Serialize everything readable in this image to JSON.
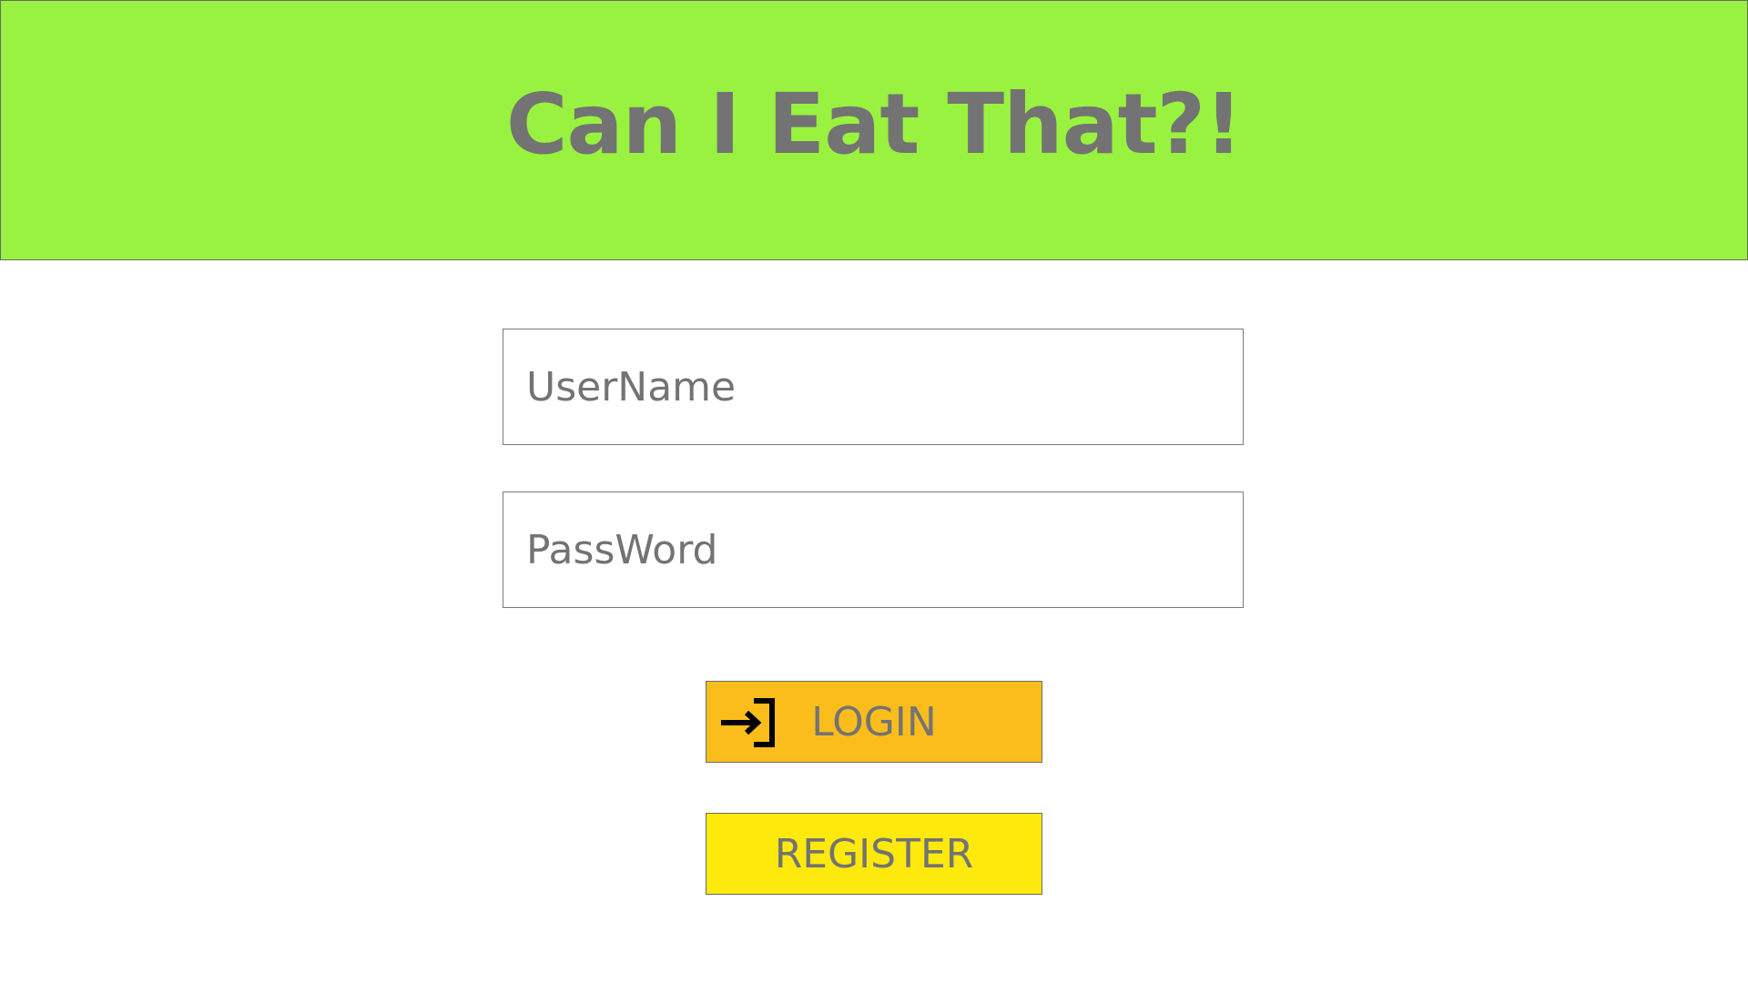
{
  "header": {
    "title": "Can I Eat That?!",
    "background_color": "#99f23f"
  },
  "form": {
    "username_placeholder": "UserName",
    "password_placeholder": "PassWord"
  },
  "buttons": {
    "login_label": "LOGIN",
    "login_icon": "login-arrow-icon",
    "login_color": "#fbbd1b",
    "register_label": "REGISTER",
    "register_color": "#fde90c"
  },
  "colors": {
    "text": "#737373"
  }
}
